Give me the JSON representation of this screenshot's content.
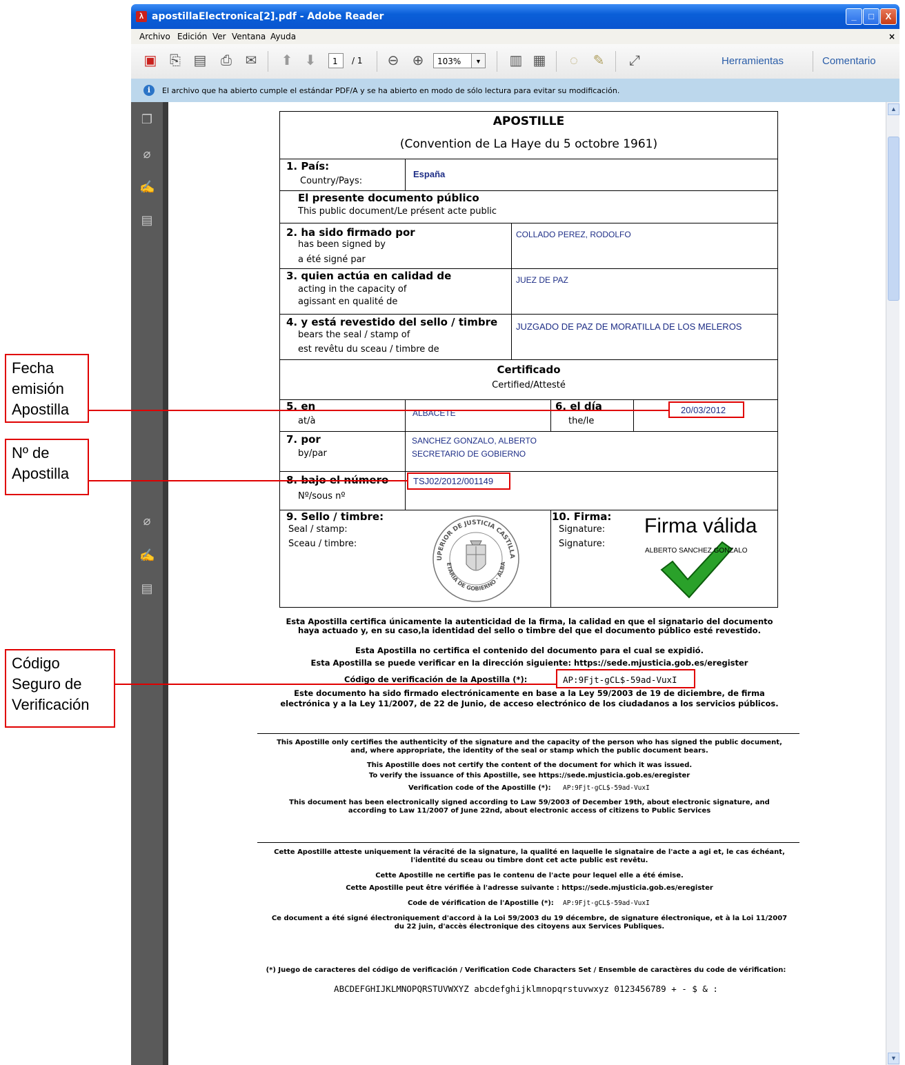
{
  "window": {
    "title": "apostillaElectronica[2].pdf - Adobe Reader",
    "controls": {
      "minimize": "_",
      "maximize": "□",
      "close": "X"
    }
  },
  "menubar": {
    "items": [
      "Archivo",
      "Edición",
      "Ver",
      "Ventana",
      "Ayuda"
    ],
    "close": "×"
  },
  "toolbar": {
    "page_current": "1",
    "page_total": "/ 1",
    "zoom": "103%",
    "tools_link": "Herramientas",
    "comment_link": "Comentario",
    "icons": [
      "create-pdf-icon",
      "export-icon",
      "save-icon",
      "print-icon",
      "email-icon",
      "prev-page-icon",
      "next-page-icon",
      "zoom-out-icon",
      "zoom-in-icon",
      "fit-page-icon",
      "fit-width-icon",
      "comment-icon",
      "highlight-icon",
      "fullscreen-icon"
    ]
  },
  "infobar": {
    "message": "El archivo que ha abierto cumple el estándar PDF/A y se ha abierto en modo de sólo lectura para evitar su modificación."
  },
  "apostille": {
    "title": "APOSTILLE",
    "subtitle": "(Convention de La Haye du 5 octobre 1961)",
    "f1_label": "1. País:",
    "f1_sub": "Country/Pays:",
    "f1_value": "España",
    "doc_label": "El presente documento público",
    "doc_sub": "This public document/Le présent acte public",
    "f2_label": "2. ha sido firmado por",
    "f2_sub1": "has been signed by",
    "f2_sub2": "a été signé par",
    "f2_value": "COLLADO PEREZ, RODOLFO",
    "f3_label": "3. quien actúa en calidad de",
    "f3_sub1": "acting in the capacity of",
    "f3_sub2": "agissant en qualité de",
    "f3_value": "JUEZ DE PAZ",
    "f4_label": "4. y está revestido del sello / timbre",
    "f4_sub1": "bears the seal / stamp of",
    "f4_sub2": "est revêtu du sceau / timbre de",
    "f4_value": "JUZGADO DE PAZ DE MORATILLA DE LOS MELEROS",
    "cert_label": "Certificado",
    "cert_sub": "Certified/Attesté",
    "f5_label": "5. en",
    "f5_sub": "at/à",
    "f5_value": "ALBACETE",
    "f6_label": "6. el día",
    "f6_sub": "the/le",
    "f6_value": "20/03/2012",
    "f7_label": "7. por",
    "f7_sub": "by/par",
    "f7_value1": "SANCHEZ GONZALO, ALBERTO",
    "f7_value2": "SECRETARIO DE GOBIERNO",
    "f8_label": "8. bajo el número",
    "f8_sub": "Nº/sous nº",
    "f8_value": "TSJ02/2012/001149",
    "f9_label": "9. Sello / timbre:",
    "f9_sub1": "Seal / stamp:",
    "f9_sub2": "Sceau / timbre:",
    "seal_text_top": "TRIBUNAL SUPERIOR DE JUSTICIA CASTILLA LA MANCHA",
    "seal_text_bottom": "SECRETARIA DE GOBIERNO · ALBACETE",
    "f10_label": "10. Firma:",
    "f10_sub1": "Signature:",
    "f10_sub2": "Signature:",
    "sig_valid": "Firma válida",
    "sig_name": "ALBERTO SANCHEZ GONZALO"
  },
  "notes_es": {
    "p1a": "Esta Apostilla certifica únicamente la autenticidad de la firma, la calidad en que el signatario del documento",
    "p1b": "haya actuado y, en su caso,la identidad del sello o timbre del que el documento público esté revestido.",
    "p2": "Esta Apostilla no certifica el contenido del documento para el cual se expidió.",
    "p3": "Esta Apostilla se puede verificar en la dirección siguiente: https://sede.mjusticia.gob.es/eregister",
    "code_label": "Código de verificación de la Apostilla (*):",
    "code": "AP:9Fjt-gCL$-59ad-VuxI",
    "p4a": "Este documento ha sido firmado electrónicamente en base a la Ley 59/2003 de 19 de diciembre, de firma",
    "p4b": "electrónica y a la Ley 11/2007, de 22 de Junio, de acceso electrónico de los ciudadanos a los servicios públicos."
  },
  "notes_en": {
    "p1a": "This Apostille only certifies the authenticity of the signature and the capacity of the person who has signed the public document,",
    "p1b": "and, where appropriate, the identity of the seal or stamp which the public document bears.",
    "p2": "This Apostille does not certify the content of the document for which it was issued.",
    "p3": "To verify the issuance of this Apostille, see  https://sede.mjusticia.gob.es/eregister",
    "code_label": "Verification code of the Apostille (*):",
    "code": "AP:9Fjt-gCL$-59ad-VuxI",
    "p4a": "This document has been electronically signed according to Law 59/2003 of December 19th, about electronic signature, and",
    "p4b": "according to Law 11/2007 of June 22nd, about electronic access of citizens to Public Services"
  },
  "notes_fr": {
    "p1a": "Cette Apostille atteste uniquement la véracité de la signature, la qualité en laquelle le signataire de l'acte a agi et, le cas échéant,",
    "p1b": "l'identité du sceau ou timbre dont cet acte public est revêtu.",
    "p2": "Cette Apostille ne certifie pas le contenu de l'acte pour lequel elle a été émise.",
    "p3": "Cette Apostille peut être vérifiée à l'adresse suivante :  https://sede.mjusticia.gob.es/eregister",
    "code_label": "Code de vérification de l'Apostille (*):",
    "code": "AP:9Fjt-gCL$-59ad-VuxI",
    "p4a": "Ce document a été signé électroniquement d'accord à la Loi 59/2003 du 19 décembre, de signature électronique, et à la Loi 11/2007",
    "p4b": "du 22 juin, d'accès électronique des citoyens aux Services Publiques."
  },
  "charset": {
    "label": "(*) Juego de caracteres del código de verificación / Verification Code Characters Set / Ensemble de caractères du code de vérification:",
    "chars": "ABCDEFGHIJKLMNOPQRSTUVWXYZ abcdefghijklmnopqrstuvwxyz 0123456789 + - $ & :"
  },
  "callouts": {
    "fecha": [
      "Fecha",
      "emisión",
      "Apostilla"
    ],
    "numero": [
      "Nº de",
      "Apostilla"
    ],
    "codigo": [
      "Código",
      "Seguro de",
      "Verificación"
    ]
  },
  "colors": {
    "highlight": "#e00000",
    "value_text": "#1d2d86",
    "titlebar": "#0a55d0"
  }
}
